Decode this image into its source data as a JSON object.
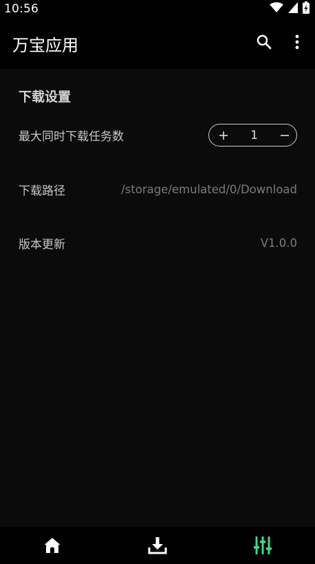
{
  "status_bar": {
    "time": "10:56",
    "icons": [
      "wifi-icon",
      "cellular-signal-icon",
      "battery-icon"
    ]
  },
  "app_bar": {
    "title": "万宝应用",
    "actions": [
      "search-icon",
      "more-vert-icon"
    ]
  },
  "settings": {
    "section_title": "下载设置",
    "max_tasks": {
      "label": "最大同时下载任务数",
      "value": "1",
      "increment_symbol": "+",
      "decrement_symbol": "−"
    },
    "download_path": {
      "label": "下载路径",
      "value": "/storage/emulated/0/Download"
    },
    "version": {
      "label": "版本更新",
      "value": "V1.0.0"
    }
  },
  "bottom_nav": {
    "items": [
      {
        "icon": "home-icon",
        "active": false
      },
      {
        "icon": "download-icon",
        "active": false
      },
      {
        "icon": "sliders-icon",
        "active": true
      }
    ],
    "active_color": "#3ddc84",
    "inactive_color": "#ffffff"
  },
  "colors": {
    "background": "#0b0b0b",
    "bar_background": "#000000",
    "accent": "#3ddc84"
  }
}
